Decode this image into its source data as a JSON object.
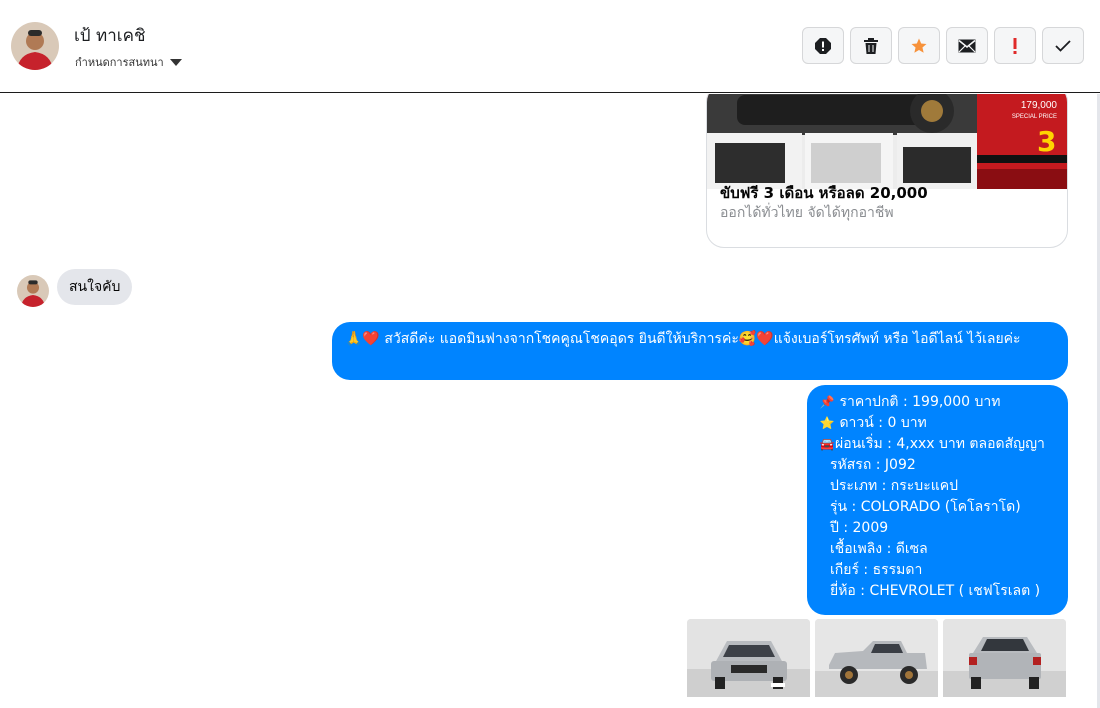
{
  "header": {
    "contact_name": "เป้ ทาเคชิ",
    "conversation_settings": "กำหนดการสนทนา",
    "actions": [
      {
        "name": "report-spam-icon",
        "color": "#1c1e21"
      },
      {
        "name": "trash-icon",
        "color": "#1c1e21"
      },
      {
        "name": "star-icon",
        "color": "#f7923b"
      },
      {
        "name": "mail-icon",
        "color": "#1c1e21"
      },
      {
        "name": "important-icon",
        "color": "#e02a2a"
      },
      {
        "name": "done-check-icon",
        "color": "#1c1e21"
      }
    ]
  },
  "link_card": {
    "title": "ขับฟรี 3 เดือน หรือลด 20,000",
    "subtitle": "ออกได้ทั่วไทย จัดได้ทุกอาชีพ",
    "price_text": "179,000",
    "special_price": "SPECIAL PRICE",
    "promo_number": "3"
  },
  "messages": {
    "incoming_1": "สนใจคับ",
    "outgoing_1": "🙏❤️ สวัสดีค่ะ แอดมินฟางจากโชคคูณโชคอุดร ยินดีให้บริการค่ะ🥰❤️แจ้งเบอร์โทรศัพท์ หรือ ไอดีไลน์  ไว้เลยค่ะ",
    "outgoing_2": {
      "price_label": "ราคาปกติ : 199,000 บาท",
      "down_label": "ดาวน์ : 0 บาท",
      "installment_label": "ผ่อนเริ่ม : 4,xxx บาท ตลอดสัญญา",
      "code": "รหัสรถ : J092",
      "type": "ประเภท : กระบะแคป",
      "model": "รุ่น : COLORADO (โคโลราโด)",
      "year": "ปี : 2009",
      "fuel": "เชื้อเพลิง : ดีเซล",
      "gear": "เกียร์ : ธรรมดา",
      "brand": "ยี่ห้อ : CHEVROLET ( เชฟโรเลต )"
    }
  },
  "colors": {
    "outgoing_bubble": "#0084ff",
    "incoming_bubble": "#e4e6eb"
  }
}
